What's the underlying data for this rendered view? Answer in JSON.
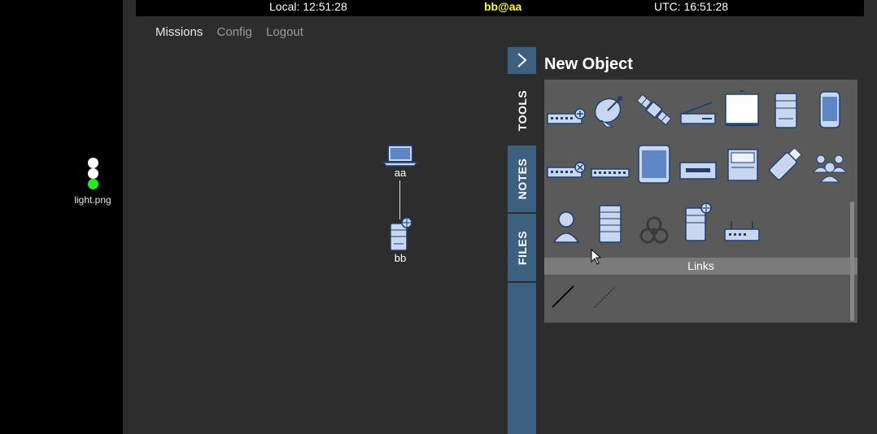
{
  "header": {
    "local_time": "Local: 12:51:28",
    "user": "bb@aa",
    "utc_time": "UTC: 16:51:28"
  },
  "nav": {
    "items": [
      {
        "label": "Missions",
        "active": true
      },
      {
        "label": "Config",
        "active": false
      },
      {
        "label": "Logout",
        "active": false
      }
    ]
  },
  "light_widget": {
    "caption": "light.png",
    "lights": [
      "#ffffff",
      "#ffffff",
      "#22ee22"
    ]
  },
  "canvas": {
    "nodes": [
      {
        "label": "aa",
        "icon": "laptop-icon"
      },
      {
        "label": "bb",
        "icon": "server-globe-icon"
      }
    ]
  },
  "sidebar": {
    "tabs": [
      {
        "label": "TOOLS",
        "active": true
      },
      {
        "label": "NOTES",
        "active": false
      },
      {
        "label": "FILES",
        "active": false
      }
    ]
  },
  "panel": {
    "title": "New Object",
    "object_icons": [
      "network-switch-add-icon",
      "satellite-dish-icon",
      "satellite-icon",
      "scanner-icon",
      "whiteboard-icon",
      "server-rack-icon",
      "mobile-phone-icon",
      "network-switch-remove-icon",
      "network-hub-icon",
      "tablet-icon",
      "tape-drive-icon",
      "printer-icon",
      "usb-drive-icon",
      "user-group-icon",
      "user-icon",
      "server-tower-icon",
      "biohazard-icon",
      "web-server-icon",
      "router-icon"
    ],
    "links_label": "Links",
    "link_icons": [
      "solid-link-icon",
      "dashed-link-icon"
    ]
  },
  "colors": {
    "accent": "#3d5f80",
    "icon_fill": "#c8d6f0",
    "icon_stroke": "#1e3f70"
  }
}
